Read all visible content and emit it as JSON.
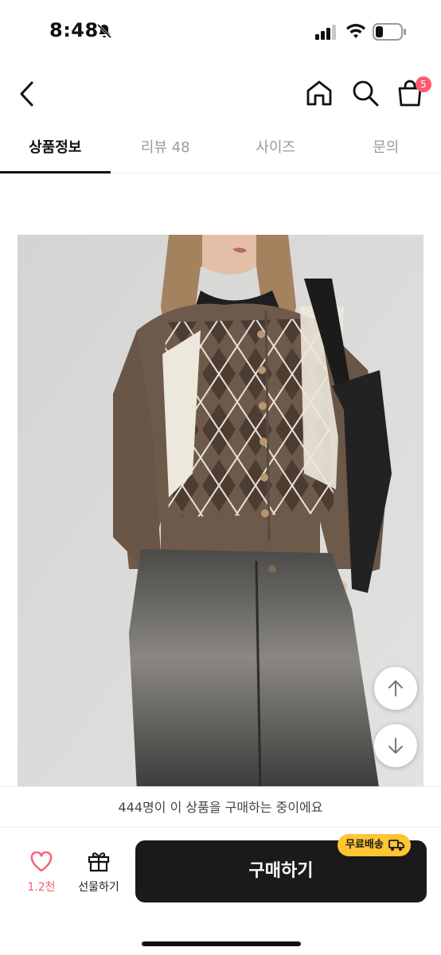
{
  "status_bar": {
    "time": "8:48",
    "battery_level": 0.25
  },
  "header": {
    "cart_count": "5"
  },
  "tabs": [
    {
      "label": "상품정보",
      "active": true
    },
    {
      "label": "리뷰 48",
      "active": false
    },
    {
      "label": "사이즈",
      "active": false
    },
    {
      "label": "문의",
      "active": false
    }
  ],
  "notice": {
    "text": "444명이 이 상품을 구매하는 중이에요"
  },
  "bottom_bar": {
    "like_count": "1.2천",
    "gift_label": "선물하기",
    "buy_label": "구매하기",
    "shipping_badge": "무료배송"
  },
  "colors": {
    "accent": "#ff5a6e",
    "shipping_badge": "#ffc533",
    "buy_button": "#1a1a1a"
  }
}
